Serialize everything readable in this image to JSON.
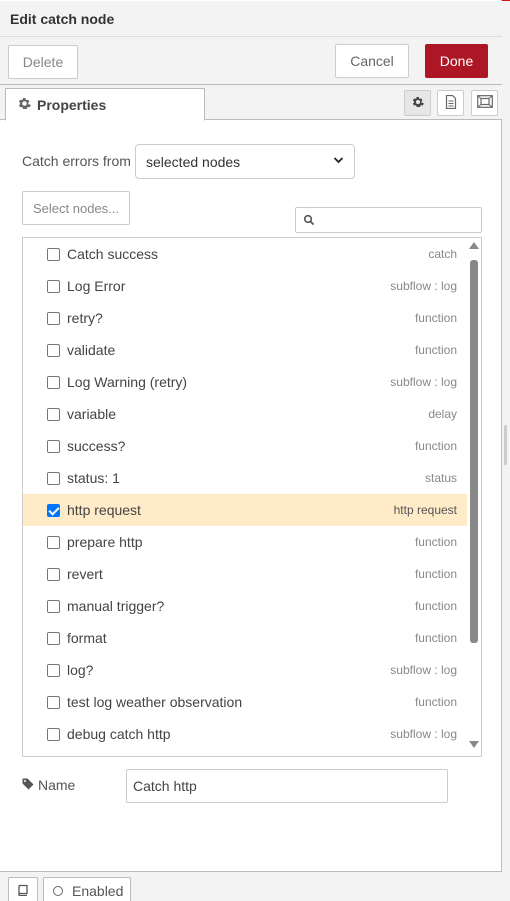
{
  "header": {
    "title": "Edit catch node"
  },
  "toolbar": {
    "delete_label": "Delete",
    "cancel_label": "Cancel",
    "done_label": "Done"
  },
  "tabs": {
    "properties_label": "Properties"
  },
  "form": {
    "catch_label": "Catch errors from",
    "catch_value": "selected nodes",
    "select_nodes_label": "Select nodes...",
    "search_placeholder": "",
    "name_label": "Name",
    "name_value": "Catch http"
  },
  "nodes": [
    {
      "label": "Catch success",
      "type": "catch",
      "checked": false
    },
    {
      "label": "Log Error",
      "type": "subflow : log",
      "checked": false
    },
    {
      "label": "retry?",
      "type": "function",
      "checked": false
    },
    {
      "label": "validate",
      "type": "function",
      "checked": false
    },
    {
      "label": "Log Warning (retry)",
      "type": "subflow : log",
      "checked": false
    },
    {
      "label": "variable",
      "type": "delay",
      "checked": false
    },
    {
      "label": "success?",
      "type": "function",
      "checked": false
    },
    {
      "label": "status: 1",
      "type": "status",
      "checked": false
    },
    {
      "label": "http request",
      "type": "http request",
      "checked": true
    },
    {
      "label": "prepare http",
      "type": "function",
      "checked": false
    },
    {
      "label": "revert",
      "type": "function",
      "checked": false
    },
    {
      "label": "manual trigger?",
      "type": "function",
      "checked": false
    },
    {
      "label": "format",
      "type": "function",
      "checked": false
    },
    {
      "label": "log?",
      "type": "subflow : log",
      "checked": false
    },
    {
      "label": "test log weather observation",
      "type": "function",
      "checked": false
    },
    {
      "label": "debug catch http",
      "type": "subflow : log",
      "checked": false
    }
  ],
  "footer": {
    "enabled_label": "Enabled"
  },
  "colors": {
    "accent": "#ad1625",
    "selected_row": "#ffebc7",
    "checkbox": "#0075ff"
  },
  "icons": {
    "tab": "gear-icon",
    "toolbar": [
      "gear-icon",
      "document-icon",
      "frame-icon"
    ],
    "search": "search-icon",
    "name": "tag-icon",
    "footer": "book-icon"
  }
}
